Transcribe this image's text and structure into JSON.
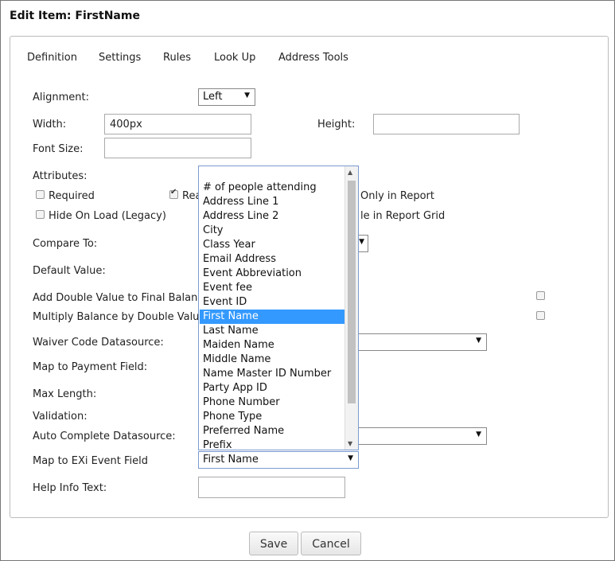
{
  "title": "Edit Item: FirstName",
  "tabs": [
    "Definition",
    "Settings",
    "Rules",
    "Look Up",
    "Address Tools"
  ],
  "form": {
    "alignment_label": "Alignment:",
    "alignment_value": "Left",
    "width_label": "Width:",
    "width_value": "400px",
    "height_label": "Height:",
    "height_value": "",
    "font_size_label": "Font Size:",
    "font_size_value": "",
    "attributes_label": "Attributes:",
    "required_label": "Required",
    "read_label_partial": "Rea",
    "only_in_report_partial": "Only in Report",
    "hide_on_load_label": "Hide On Load (Legacy)",
    "in_report_grid_partial": "le in Report Grid",
    "compare_to_label": "Compare To:",
    "default_value_label": "Default Value:",
    "add_double_label": "Add Double Value to Final Balance",
    "multiply_balance_label": "Multiply Balance by Double Value:",
    "waiver_code_label": "Waiver Code Datasource:",
    "map_payment_label": "Map to Payment Field:",
    "max_length_label": "Max Length:",
    "validation_label": "Validation:",
    "auto_complete_label": "Auto Complete Datasource:",
    "map_exi_label": "Map to EXi Event Field",
    "map_exi_value": "First Name",
    "help_info_label": "Help Info Text:",
    "help_info_value": ""
  },
  "dropdown": {
    "options": [
      "# of people attending",
      "Address Line 1",
      "Address Line 2",
      "City",
      "Class Year",
      "Email Address",
      "Event Abbreviation",
      "Event fee",
      "Event ID",
      "First Name",
      "Last Name",
      "Maiden Name",
      "Middle Name",
      "Name Master ID Number",
      "Party App ID",
      "Phone Number",
      "Phone Type",
      "Preferred Name",
      "Prefix"
    ],
    "selected": "First Name"
  },
  "buttons": {
    "save": "Save",
    "cancel": "Cancel"
  },
  "colors": {
    "highlight": "#3399ff"
  }
}
